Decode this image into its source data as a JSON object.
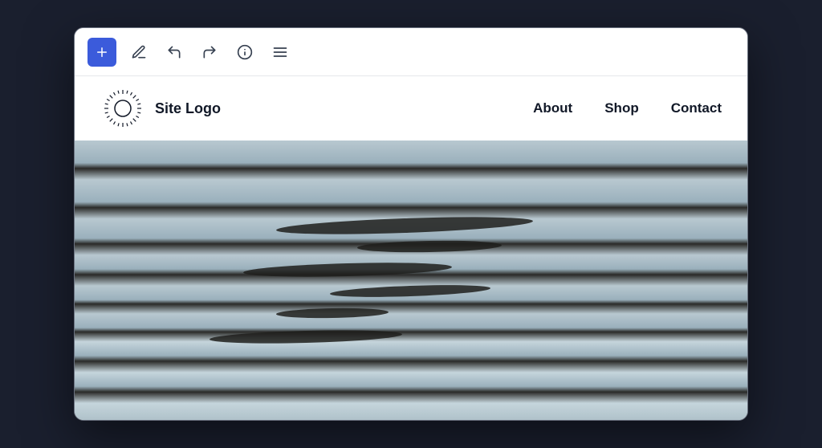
{
  "toolbar": {
    "add_label": "+",
    "icons": {
      "pen": "pen-icon",
      "undo": "undo-icon",
      "redo": "redo-icon",
      "info": "info-icon",
      "menu": "menu-icon"
    }
  },
  "site_header": {
    "logo_text": "Site Logo",
    "nav_items": [
      {
        "label": "About"
      },
      {
        "label": "Shop"
      },
      {
        "label": "Contact"
      }
    ]
  },
  "hero": {
    "alt": "Aerial view of striped sand dunes and water"
  }
}
